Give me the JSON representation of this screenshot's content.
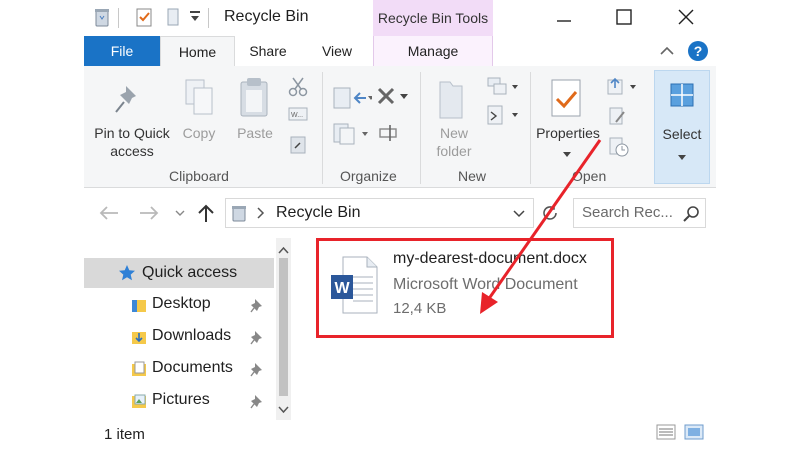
{
  "window": {
    "title": "Recycle Bin",
    "contextual_tab": "Recycle Bin Tools"
  },
  "tabs": {
    "file": "File",
    "home": "Home",
    "share": "Share",
    "view": "View",
    "manage": "Manage"
  },
  "ribbon": {
    "clipboard": {
      "group_label": "Clipboard",
      "pin_label_1": "Pin to Quick",
      "pin_label_2": "access",
      "copy": "Copy",
      "paste": "Paste"
    },
    "organize": {
      "group_label": "Organize"
    },
    "new": {
      "group_label": "New",
      "new_folder_1": "New",
      "new_folder_2": "folder"
    },
    "open": {
      "group_label": "Open",
      "properties": "Properties"
    },
    "select": {
      "label": "Select"
    }
  },
  "address": {
    "path": "Recycle Bin",
    "search_placeholder": "Search Rec..."
  },
  "nav": {
    "quick_access": "Quick access",
    "items": [
      {
        "label": "Desktop"
      },
      {
        "label": "Downloads"
      },
      {
        "label": "Documents"
      },
      {
        "label": "Pictures"
      }
    ]
  },
  "file": {
    "name": "my-dearest-document.docx",
    "type": "Microsoft Word Document",
    "size": "12,4 KB"
  },
  "status": {
    "count": "1 item"
  },
  "colors": {
    "accent": "#1a73c6",
    "contextual_tab": "#f2dcf7",
    "highlight_red": "#e8232a",
    "word_blue": "#2b579a"
  }
}
